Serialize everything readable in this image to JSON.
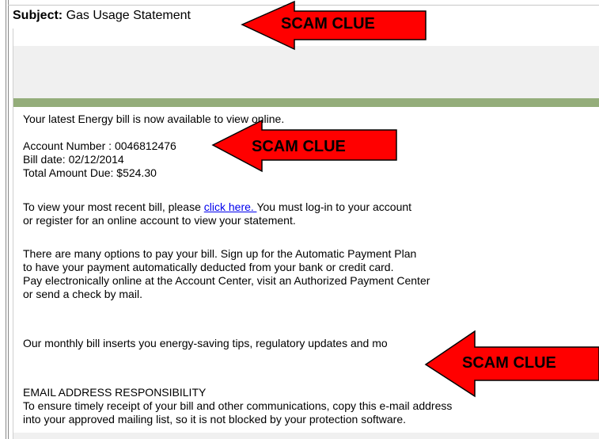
{
  "email": {
    "subject_label": "Subject:",
    "subject_value": "Gas Usage Statement",
    "intro": "Your latest Energy bill is now available to view online.",
    "account_number": "Account Number : 0046812476",
    "bill_date": "Bill date: 02/12/2014",
    "total_due": "Total Amount Due: $524.30",
    "view_bill_pre": "To view your most recent bill, please ",
    "view_bill_link": "click here. ",
    "view_bill_post": "You must log-in to your account",
    "view_bill_line2": "or register for an online account to view your statement.",
    "pay_line1": "There are many options to pay your bill. Sign up for the Automatic Payment Plan",
    "pay_line2": "to have your payment automatically deducted from your bank or credit card.",
    "pay_line3": "Pay electronically online at the Account Center, visit an Authorized Payment Center",
    "pay_line4": "or send a check by mail.",
    "inserts": "Our monthly bill inserts you energy-saving tips, regulatory updates and mo",
    "responsibility_heading": "EMAIL ADDRESS RESPONSIBILITY",
    "responsibility_line1": "To ensure timely receipt of your bill and other communications, copy this e-mail address",
    "responsibility_line2": "into your approved mailing list, so it is not blocked by your protection software."
  },
  "annotations": {
    "arrow_color": "#ff0000",
    "clue_1": "SCAM CLUE",
    "clue_2": "SCAM CLUE",
    "clue_3": "SCAM CLUE"
  },
  "colors": {
    "link": "#0000ee",
    "header_band": "#94ad7a",
    "gray_band": "#f0f0f0"
  }
}
